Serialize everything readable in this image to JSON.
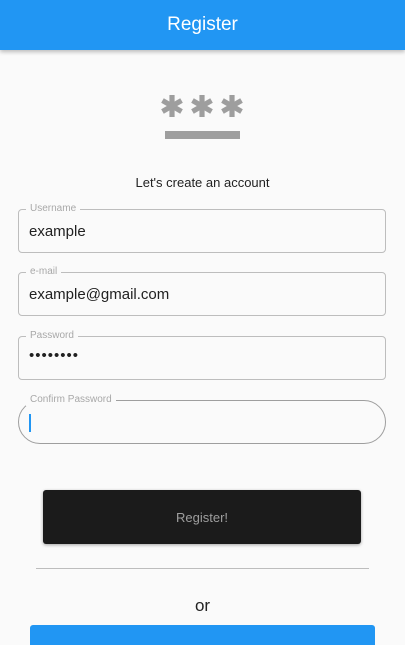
{
  "appbar": {
    "title": "Register"
  },
  "logo": {
    "icon": "password-icon"
  },
  "subtitle": "Let's create an account",
  "fields": {
    "username": {
      "label": "Username",
      "value": "example"
    },
    "email": {
      "label": "e-mail",
      "value": "example@gmail.com"
    },
    "password": {
      "label": "Password",
      "value": "••••••••"
    },
    "confirm_password": {
      "label": "Confirm Password",
      "value": ""
    }
  },
  "register_button": {
    "label": "Register!"
  },
  "or_text": "or",
  "colors": {
    "primary": "#2196F3",
    "button_dark": "#1b1b1b",
    "background": "#fafafa"
  }
}
